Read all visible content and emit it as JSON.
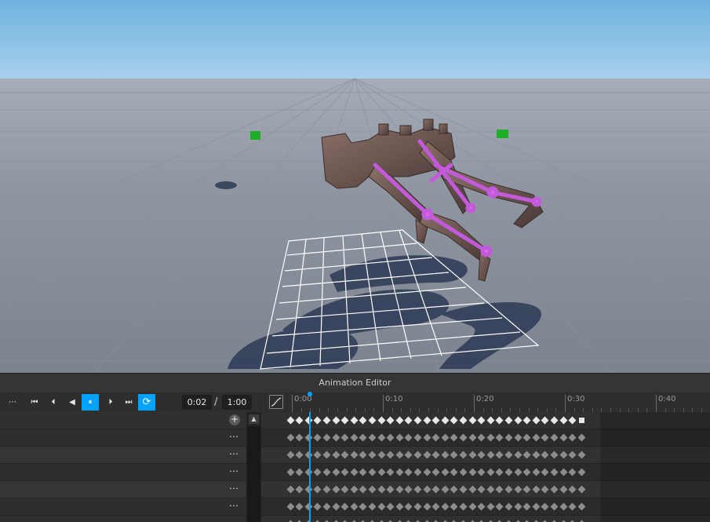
{
  "editor": {
    "title": "Animation Editor"
  },
  "toolbar": {
    "more_label": "⋯",
    "first_label": "⏮",
    "prev_label": "⏴",
    "reverse_label": "◀",
    "pause_label": "⏸",
    "next_label": "⏵",
    "last_label": "⏭",
    "loop_label": "⟳",
    "current_time": "0:02",
    "separator": "/",
    "total_time": "1:00"
  },
  "ruler": {
    "labels": [
      "0:00",
      "0:10",
      "0:20",
      "0:30",
      "0:40"
    ]
  },
  "tracks": {
    "add_label": "+",
    "rows": [
      {
        "menu": ""
      },
      {
        "menu": "⋯"
      },
      {
        "menu": "⋯"
      },
      {
        "menu": "⋯"
      },
      {
        "menu": "⋯"
      },
      {
        "menu": "⋯"
      }
    ]
  },
  "timeline": {
    "playhead_time": "0:02",
    "keyframe_count_per_row": 33,
    "colors": {
      "accent": "#00a2ff",
      "keyframe_summary": "#e8e8e8",
      "keyframe_track": "#8c8c8c",
      "bone": "#c35adc"
    }
  },
  "icons": {
    "more": "more-icon",
    "first": "skip-to-start-icon",
    "prev": "step-back-icon",
    "reverse": "play-reverse-icon",
    "pause": "pause-icon",
    "next": "step-forward-icon",
    "last": "skip-to-end-icon",
    "loop": "loop-icon",
    "curve": "curve-editor-icon",
    "add": "add-track-icon",
    "scroll_up": "scroll-up-icon"
  },
  "scrollbar": {
    "up_label": "▲"
  }
}
